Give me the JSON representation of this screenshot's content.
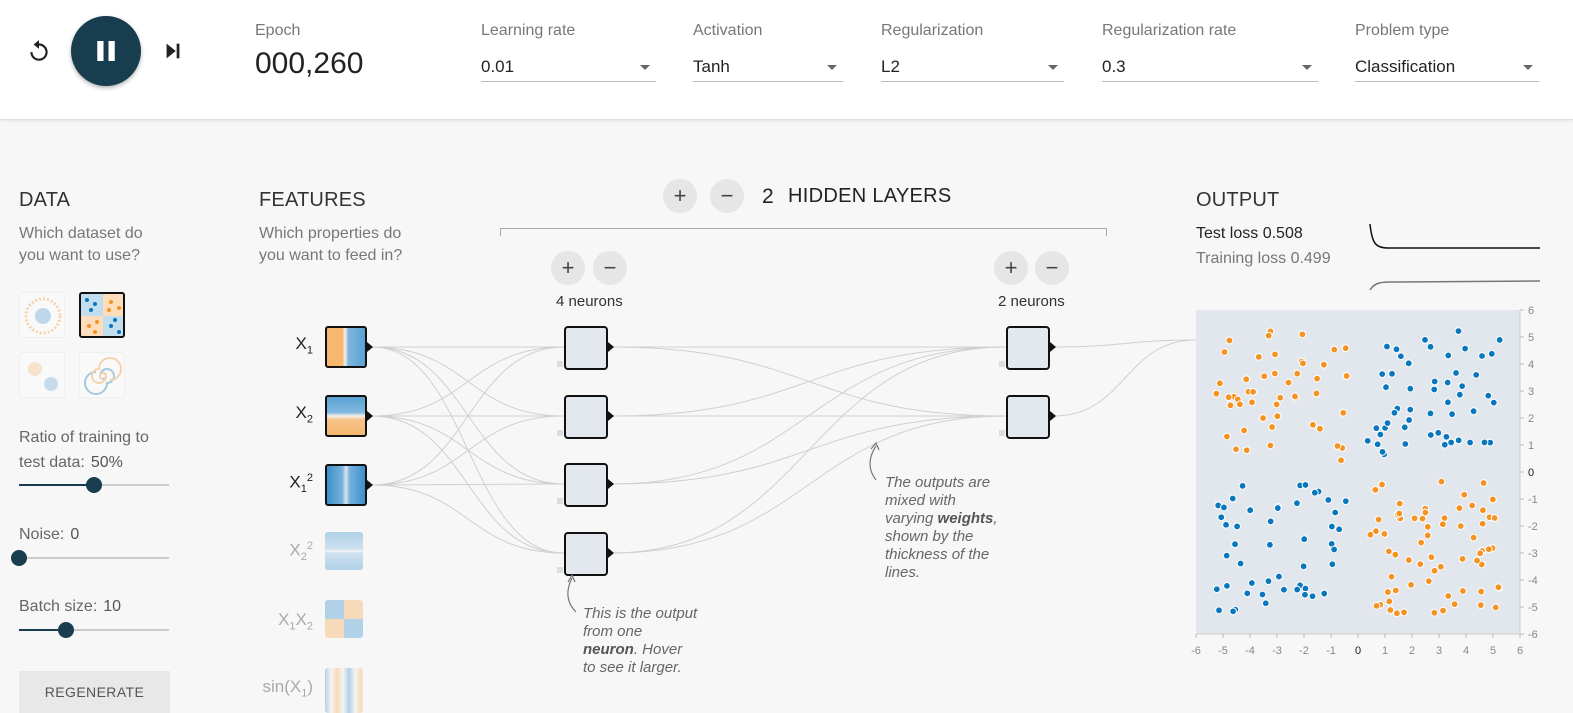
{
  "toolbar": {
    "epoch_label": "Epoch",
    "epoch_value": "000,260",
    "learning_rate_label": "Learning rate",
    "learning_rate_value": "0.01",
    "activation_label": "Activation",
    "activation_value": "Tanh",
    "regularization_label": "Regularization",
    "regularization_value": "L2",
    "regularization_rate_label": "Regularization rate",
    "regularization_rate_value": "0.3",
    "problem_type_label": "Problem type",
    "problem_type_value": "Classification",
    "icons": [
      "reset-icon",
      "pause-icon",
      "step-icon"
    ]
  },
  "data": {
    "title": "DATA",
    "subtitle_line1": "Which dataset do",
    "subtitle_line2": "you want to use?",
    "ratio_label_line1": "Ratio of training to",
    "ratio_label_line2": "test data:",
    "ratio_value": "50%",
    "ratio_fraction": 0.5,
    "noise_label": "Noise:",
    "noise_value": "0",
    "noise_fraction": 0,
    "batch_label": "Batch size:",
    "batch_value": "10",
    "batch_fraction": 0.31,
    "regenerate_label": "REGENERATE",
    "selected_dataset": "xor"
  },
  "features": {
    "title": "FEATURES",
    "subtitle_line1": "Which properties do",
    "subtitle_line2": "you want to feed in?",
    "items": [
      {
        "base": "X",
        "sub": "1",
        "sup": "",
        "active": true
      },
      {
        "base": "X",
        "sub": "2",
        "sup": "",
        "active": true
      },
      {
        "base": "X",
        "sub": "1",
        "sup": "2",
        "active": true
      },
      {
        "base": "X",
        "sub": "2",
        "sup": "2",
        "active": false
      },
      {
        "base": "X",
        "sub": "1",
        "sup": "",
        "base2": "X",
        "sub2": "2",
        "active": false
      },
      {
        "base": "sin(X",
        "sub": "1",
        "sup": "",
        "tail": ")",
        "active": false
      }
    ]
  },
  "network": {
    "layers_count": "2",
    "layers_label": "HIDDEN LAYERS",
    "add_icon": "+",
    "remove_icon": "−",
    "layer1_neurons": "4 neurons",
    "layer2_neurons": "2 neurons"
  },
  "notes": {
    "neuron_line1": "This is the output",
    "neuron_line2": "from one",
    "neuron_bold": "neuron",
    "neuron_line3": ". Hover",
    "neuron_line4": "to see it larger.",
    "weights_line1": "The outputs are",
    "weights_line2": "mixed with",
    "weights_pre": "varying ",
    "weights_bold": "weights",
    "weights_post": ",",
    "weights_line4": "shown by the",
    "weights_line5": "thickness of the",
    "weights_line6": "lines."
  },
  "output": {
    "title": "OUTPUT",
    "test_loss_label": "Test loss",
    "test_loss_value": "0.508",
    "train_loss_label": "Training loss",
    "train_loss_value": "0.499",
    "x_ticks": [
      "-6",
      "-5",
      "-4",
      "-3",
      "-2",
      "-1",
      "0",
      "1",
      "2",
      "3",
      "4",
      "5",
      "6"
    ],
    "y_ticks": [
      "6",
      "5",
      "4",
      "3",
      "2",
      "1",
      "0",
      "-1",
      "-2",
      "-3",
      "-4",
      "-5",
      "-6"
    ],
    "colors": {
      "orange": "#f59322",
      "blue": "#0877bd",
      "plot_bg": "#e1e7ec"
    }
  }
}
